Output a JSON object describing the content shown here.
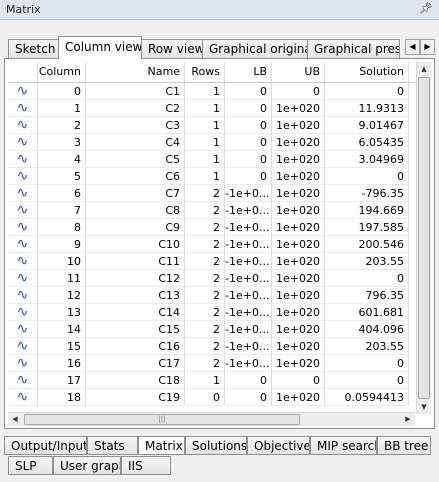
{
  "window": {
    "title": "Matrix",
    "pin_glyph": "ᵖ"
  },
  "top_tabs": [
    {
      "label": "Sketch"
    },
    {
      "label": "Column view"
    },
    {
      "label": "Row view"
    },
    {
      "label": "Graphical original"
    },
    {
      "label": "Graphical presol"
    }
  ],
  "active_top_tab": "Column view",
  "grid": {
    "headers": {
      "column": "Column",
      "name": "Name",
      "rows": "Rows",
      "lb": "LB",
      "ub": "UB",
      "solution": "Solution"
    },
    "icon": "wave-icon",
    "rows": [
      {
        "column": "0",
        "name": "C1",
        "rows": "1",
        "lb": "0",
        "ub": "0",
        "solution": "0"
      },
      {
        "column": "1",
        "name": "C2",
        "rows": "1",
        "lb": "0",
        "ub": "1e+020",
        "solution": "11.9313"
      },
      {
        "column": "2",
        "name": "C3",
        "rows": "1",
        "lb": "0",
        "ub": "1e+020",
        "solution": "9.01467"
      },
      {
        "column": "3",
        "name": "C4",
        "rows": "1",
        "lb": "0",
        "ub": "1e+020",
        "solution": "6.05435"
      },
      {
        "column": "4",
        "name": "C5",
        "rows": "1",
        "lb": "0",
        "ub": "1e+020",
        "solution": "3.04969"
      },
      {
        "column": "5",
        "name": "C6",
        "rows": "1",
        "lb": "0",
        "ub": "1e+020",
        "solution": "0"
      },
      {
        "column": "6",
        "name": "C7",
        "rows": "2",
        "lb": "-1e+0...",
        "ub": "1e+020",
        "solution": "-796.35"
      },
      {
        "column": "7",
        "name": "C8",
        "rows": "2",
        "lb": "-1e+0...",
        "ub": "1e+020",
        "solution": "194.669"
      },
      {
        "column": "8",
        "name": "C9",
        "rows": "2",
        "lb": "-1e+0...",
        "ub": "1e+020",
        "solution": "197.585"
      },
      {
        "column": "9",
        "name": "C10",
        "rows": "2",
        "lb": "-1e+0...",
        "ub": "1e+020",
        "solution": "200.546"
      },
      {
        "column": "10",
        "name": "C11",
        "rows": "2",
        "lb": "-1e+0...",
        "ub": "1e+020",
        "solution": "203.55"
      },
      {
        "column": "11",
        "name": "C12",
        "rows": "2",
        "lb": "-1e+0...",
        "ub": "1e+020",
        "solution": "0"
      },
      {
        "column": "12",
        "name": "C13",
        "rows": "2",
        "lb": "-1e+0...",
        "ub": "1e+020",
        "solution": "796.35"
      },
      {
        "column": "13",
        "name": "C14",
        "rows": "2",
        "lb": "-1e+0...",
        "ub": "1e+020",
        "solution": "601.681"
      },
      {
        "column": "14",
        "name": "C15",
        "rows": "2",
        "lb": "-1e+0...",
        "ub": "1e+020",
        "solution": "404.096"
      },
      {
        "column": "15",
        "name": "C16",
        "rows": "2",
        "lb": "-1e+0...",
        "ub": "1e+020",
        "solution": "203.55"
      },
      {
        "column": "16",
        "name": "C17",
        "rows": "2",
        "lb": "-1e+0...",
        "ub": "1e+020",
        "solution": "0"
      },
      {
        "column": "17",
        "name": "C18",
        "rows": "1",
        "lb": "0",
        "ub": "0",
        "solution": "0"
      },
      {
        "column": "18",
        "name": "C19",
        "rows": "0",
        "lb": "0",
        "ub": "1e+020",
        "solution": "0.0594413"
      }
    ]
  },
  "bottom_tabs": [
    {
      "label": "Output/Input"
    },
    {
      "label": "Stats"
    },
    {
      "label": "Matrix"
    },
    {
      "label": "Solutions"
    },
    {
      "label": "Objective"
    },
    {
      "label": "MIP search"
    },
    {
      "label": "BB tree"
    },
    {
      "label": "SLP"
    },
    {
      "label": "User graph"
    },
    {
      "label": "IIS"
    }
  ],
  "active_bottom_tab": "Matrix"
}
